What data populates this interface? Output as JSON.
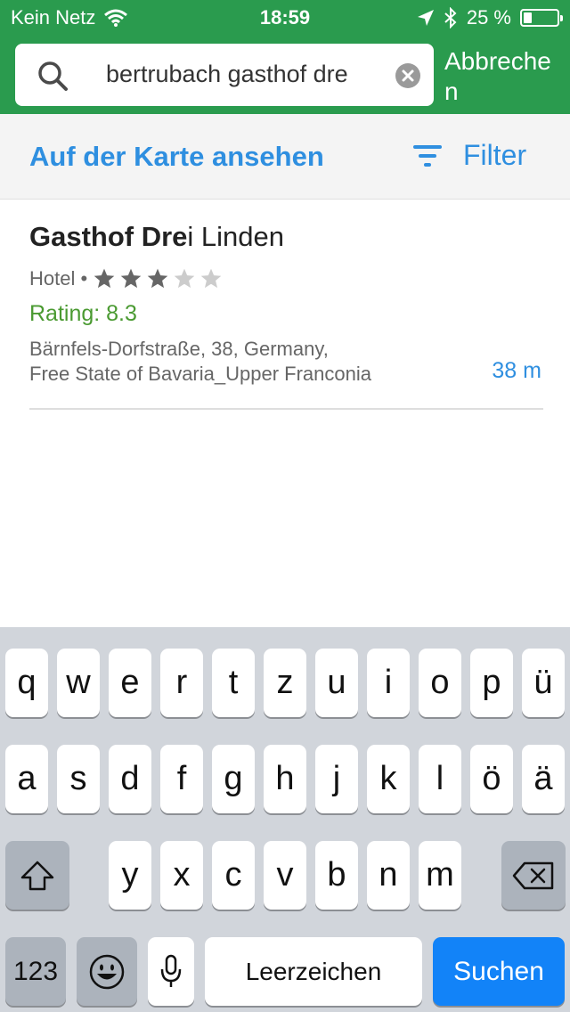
{
  "status_bar": {
    "carrier": "Kein Netz",
    "time": "18:59",
    "battery_percent": "25 %",
    "battery_level": 0.25
  },
  "search": {
    "query_visible": "bertrubach gasthof dre",
    "cancel_label": "Abbrechen"
  },
  "toolbar": {
    "map_link": "Auf der Karte ansehen",
    "filter_label": "Filter"
  },
  "results": [
    {
      "title_match": "Gasthof Dre",
      "title_rest": "i Linden",
      "category": "Hotel •",
      "stars": 3,
      "stars_max": 5,
      "rating": "Rating: 8.3",
      "address_line1": "Bärnfels-Dorfstraße, 38, Germany,",
      "address_line2": "Free State of Bavaria_Upper Franconia",
      "distance": "38 m"
    }
  ],
  "keyboard": {
    "row1": [
      "q",
      "w",
      "e",
      "r",
      "t",
      "z",
      "u",
      "i",
      "o",
      "p",
      "ü"
    ],
    "row2": [
      "a",
      "s",
      "d",
      "f",
      "g",
      "h",
      "j",
      "k",
      "l",
      "ö",
      "ä"
    ],
    "row3": [
      "y",
      "x",
      "c",
      "v",
      "b",
      "n",
      "m"
    ],
    "numbers_key": "123",
    "space_label": "Leerzeichen",
    "return_label": "Suchen"
  },
  "colors": {
    "header_green": "#2a9b4e",
    "link_blue": "#2f8fe0",
    "rating_green": "#4a9a31",
    "keyboard_bg": "#d1d5db",
    "return_key_blue": "#1283f8"
  }
}
